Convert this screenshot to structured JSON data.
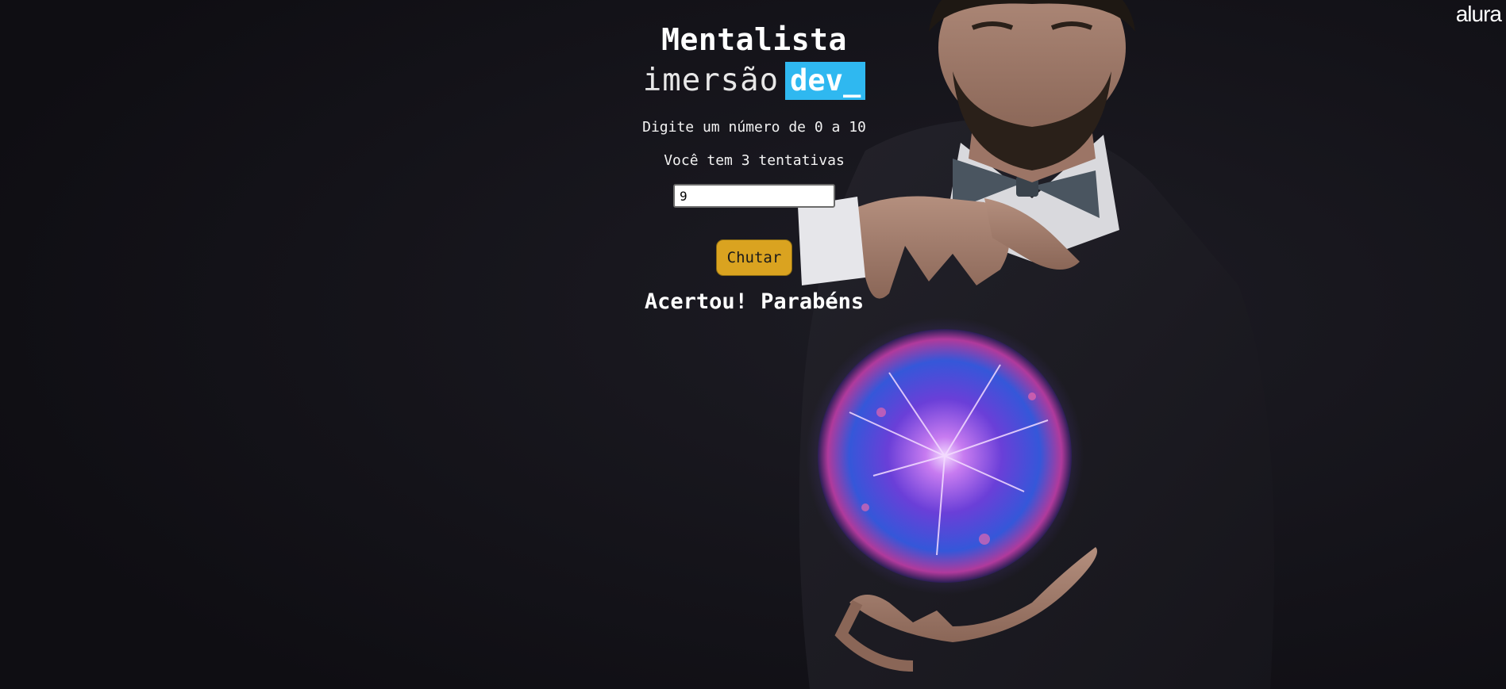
{
  "brand": "alura",
  "title": "Mentalista",
  "logo": {
    "word": "imersão",
    "badge": "dev_"
  },
  "instruction": "Digite um número de 0 a 10",
  "attempts_text": "Você tem 3 tentativas",
  "guess_input": {
    "value": "9",
    "placeholder": ""
  },
  "guess_button_label": "Chutar",
  "result_message": "Acertou! Parabéns",
  "colors": {
    "background": "#121117",
    "badge": "#2fb8f0",
    "button": "#daa320",
    "text": "#ffffff"
  }
}
